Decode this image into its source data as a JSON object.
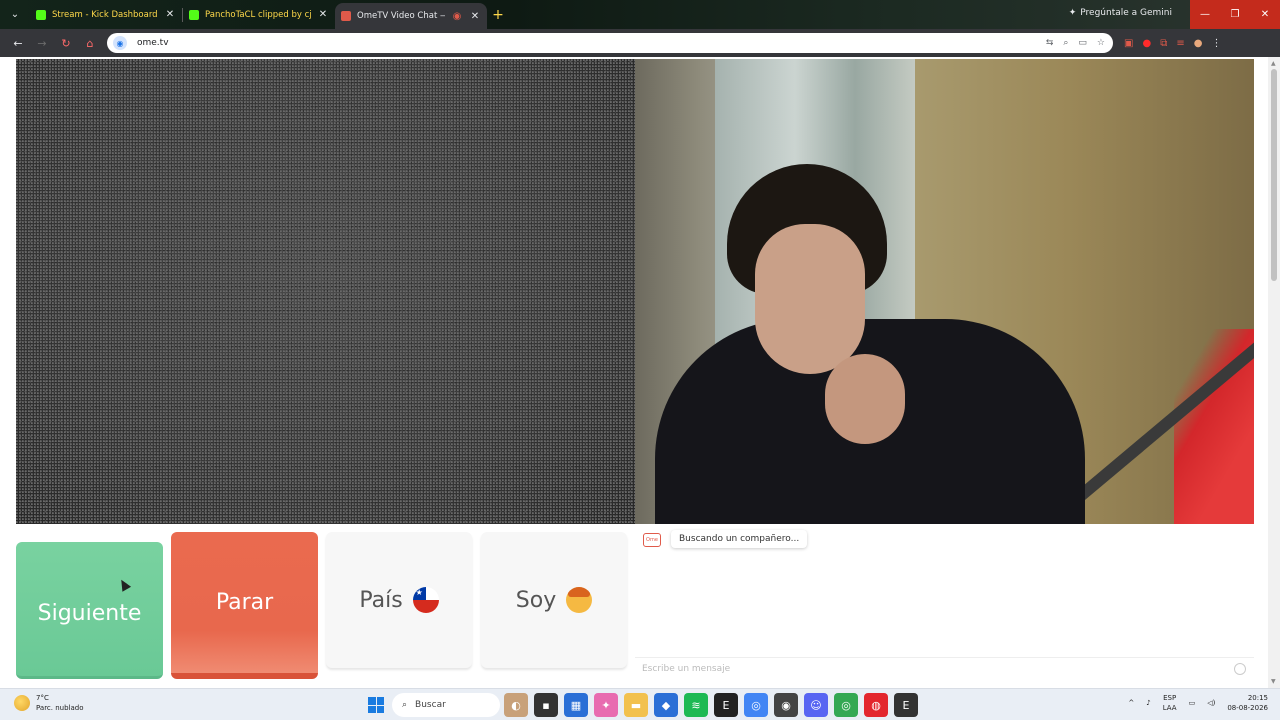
{
  "browser": {
    "tabs": [
      {
        "title": "Stream - Kick Dashboard",
        "favicon_color": "#53fc18",
        "active": false
      },
      {
        "title": "PanchoTaCL clipped by cjskejrh",
        "favicon_color": "#53fc18",
        "active": false
      },
      {
        "title": "OmeTV Video Chat — Ome",
        "favicon_color": "#e05a4a",
        "active": true
      }
    ],
    "gemini_label": "Pregúntale a Gemini",
    "url": "ome.tv"
  },
  "page": {
    "buttons": {
      "next_label": "Siguiente",
      "stop_label": "Parar",
      "country_label": "País",
      "gender_label": "Soy"
    },
    "chat": {
      "status_text": "Buscando un compañero...",
      "input_placeholder": "Escribe un mensaje"
    },
    "colors": {
      "next": "#6fcf97",
      "stop": "#e8684d"
    }
  },
  "taskbar": {
    "weather_temp": "7°C",
    "weather_desc": "Parc. nublado",
    "search_placeholder": "Buscar",
    "lang_top": "ESP",
    "lang_bottom": "LAA",
    "time": "20:15",
    "date": "08-08-2026"
  }
}
